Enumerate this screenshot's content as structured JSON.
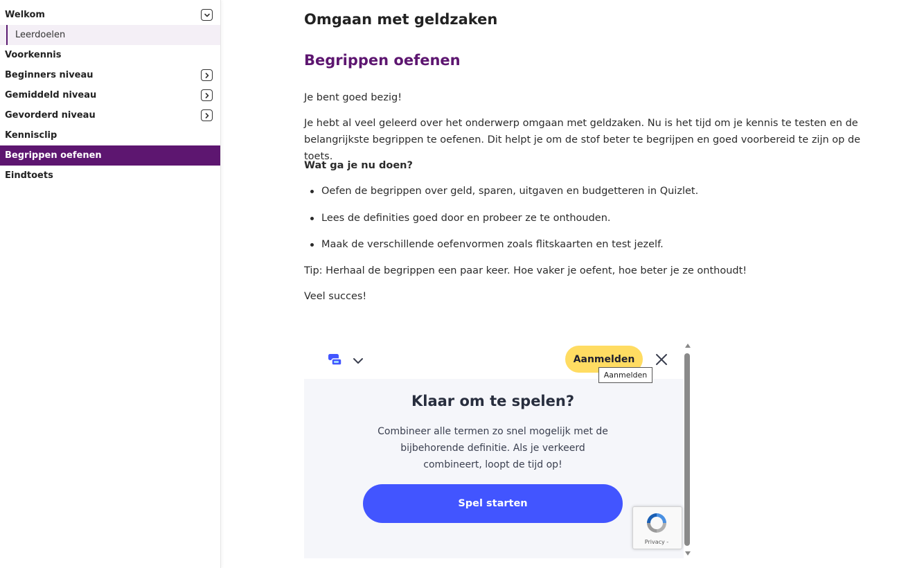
{
  "sidebar": {
    "items": [
      {
        "label": "Welkom",
        "toggle": "expanded"
      },
      {
        "label": "Leerdoelen",
        "sub": true
      },
      {
        "label": "Voorkennis"
      },
      {
        "label": "Beginners niveau",
        "toggle": "collapsed"
      },
      {
        "label": "Gemiddeld niveau",
        "toggle": "collapsed"
      },
      {
        "label": "Gevorderd niveau",
        "toggle": "collapsed"
      },
      {
        "label": "Kennisclip"
      },
      {
        "label": "Begrippen oefenen",
        "active": true
      },
      {
        "label": "Eindtoets"
      }
    ],
    "active_color": "#5d1670"
  },
  "main": {
    "page_title": "Omgaan met geldzaken",
    "section_title": "Begrippen oefenen",
    "intro": "Je bent goed bezig!",
    "paragraph": "Je hebt al veel geleerd over het onderwerp omgaan met geldzaken. Nu is het tijd om je kennis te testen en de belangrijkste begrippen  te oefenen. Dit helpt je om de stof beter te begrijpen en goed voorbereid te zijn op de toets.",
    "question": "Wat ga je nu doen?",
    "bullets": [
      "Oefen de begrippen over geld, sparen, uitgaven en budgetteren in Quizlet.",
      "Lees de definities goed door en probeer ze te onthouden.",
      "Maak de verschillende oefenvormen zoals flitskaarten en test jezelf."
    ],
    "tip": "Tip: Herhaal de begrippen een paar keer. Hoe vaker je oefent, hoe beter je ze onthoudt!",
    "closing": "Veel succes!"
  },
  "widget": {
    "login_label": "Aanmelden",
    "tooltip": "Aanmelden",
    "title": "Klaar om te spelen?",
    "description": "Combineer alle termen zo snel mogelijk met de bijbehorende definitie. Als je verkeerd combineert, loopt de tijd op!",
    "start_label": "Spel starten",
    "accent_color": "#4255ff",
    "login_color": "#ffdc62"
  },
  "recaptcha": {
    "label": "Privacy -"
  }
}
